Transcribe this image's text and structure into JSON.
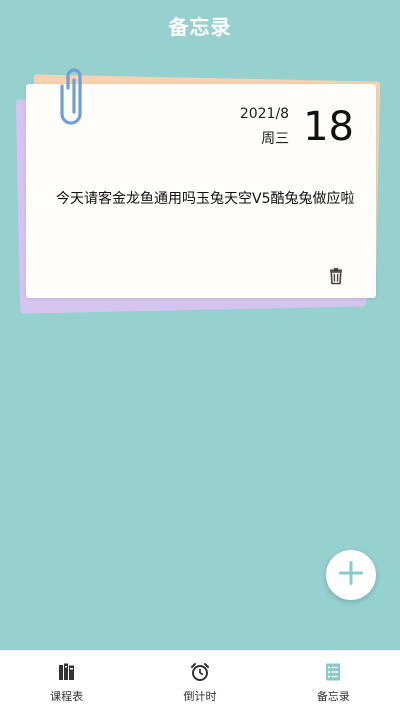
{
  "header": {
    "title": "备忘录"
  },
  "note": {
    "year_month": "2021/8",
    "weekday": "周三",
    "day": "18",
    "text": "今天请客金龙鱼通用吗玉兔天空V5酷兔兔做应啦"
  },
  "icons": {
    "paperclip": "paperclip-icon",
    "delete": "trash-icon",
    "add": "plus-icon",
    "timetable": "books-icon",
    "countdown": "alarm-clock-icon",
    "memo": "list-icon"
  },
  "colors": {
    "background": "#96d1d0",
    "accent": "#86cbc9",
    "paper": "#fffdfa",
    "paper_peach": "#f7d1b0",
    "paper_lilac": "#d6c4f0",
    "clip": "#6f9fd8"
  },
  "bottom_nav": {
    "items": [
      {
        "label": "课程表"
      },
      {
        "label": "倒计时"
      },
      {
        "label": "备忘录"
      }
    ],
    "active": "备忘录"
  }
}
